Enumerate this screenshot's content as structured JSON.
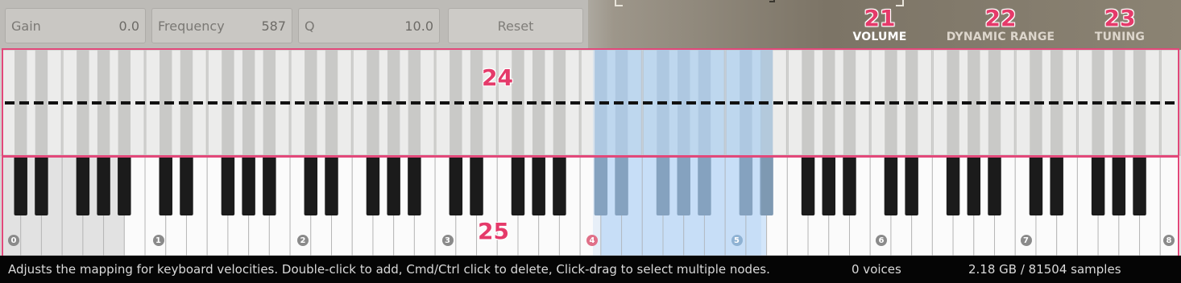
{
  "eq": {
    "gain_label": "Gain",
    "gain_value": "0.0",
    "frequency_label": "Frequency",
    "frequency_value": "587",
    "q_label": "Q",
    "q_value": "10.0",
    "reset_label": "Reset"
  },
  "knobs": [
    {
      "number": "21",
      "label": "VOLUME",
      "color": "#ffffff"
    },
    {
      "number": "22",
      "label": "DYNAMIC RANGE",
      "color": "#ddd6cc"
    },
    {
      "number": "23",
      "label": "TUNING",
      "color": "#ddd6cc"
    }
  ],
  "annotations": {
    "velocity_panel": "24",
    "keyboard_panel": "25"
  },
  "octave_labels": [
    "0",
    "1",
    "2",
    "3",
    "4",
    "5",
    "6",
    "7",
    "8"
  ],
  "status": {
    "help_text": "Adjusts the mapping for keyboard velocities. Double-click to add, Cmd/Ctrl click to delete, Click-drag to select multiple nodes.",
    "voices": "0 voices",
    "memory": "2.18 GB / 81504 samples"
  },
  "colors": {
    "annotation": "#e53a6a",
    "selection": "#bcd9f5",
    "octave_label_active": "#e07088"
  }
}
